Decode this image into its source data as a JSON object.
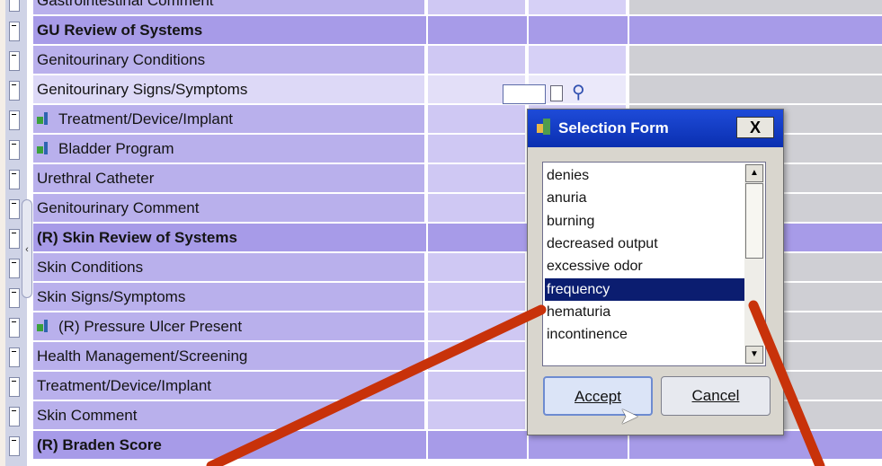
{
  "grid_rows": [
    {
      "label": "Gastrointestinal Comment",
      "type": "normal"
    },
    {
      "label": "GU Review of Systems",
      "type": "header"
    },
    {
      "label": "Genitourinary Conditions",
      "type": "normal"
    },
    {
      "label": "Genitourinary Signs/Symptoms",
      "type": "highlight"
    },
    {
      "label": "Treatment/Device/Implant",
      "type": "icon"
    },
    {
      "label": "Bladder Program",
      "type": "icon"
    },
    {
      "label": "Urethral Catheter",
      "type": "normal"
    },
    {
      "label": "Genitourinary Comment",
      "type": "normal"
    },
    {
      "label": "(R) Skin Review of Systems",
      "type": "header"
    },
    {
      "label": "Skin Conditions",
      "type": "normal"
    },
    {
      "label": "Skin Signs/Symptoms",
      "type": "normal"
    },
    {
      "label": "(R) Pressure Ulcer Present",
      "type": "icon"
    },
    {
      "label": "Health Management/Screening",
      "type": "normal"
    },
    {
      "label": "Treatment/Device/Implant",
      "type": "normal"
    },
    {
      "label": "Skin Comment",
      "type": "normal"
    },
    {
      "label": "(R) Braden Score",
      "type": "header"
    }
  ],
  "dialog": {
    "title": "Selection Form",
    "close_label": "X",
    "options": [
      "denies",
      "anuria",
      "burning",
      "decreased output",
      "excessive odor",
      "frequency",
      "hematuria",
      "incontinence"
    ],
    "selected": "frequency",
    "accept_label": "Accept",
    "cancel_label": "Cancel"
  },
  "colors": {
    "header_row": "#a79be8",
    "label_cell": "#b9b0ec",
    "selection": "#0b1d70",
    "titlebar": "#1e4bd8",
    "annotation_line": "#c8320a"
  },
  "icons": {
    "inline_lookup": "magnifier-icon",
    "inline_doc": "document-icon",
    "row_icon": "flowsheet-icon",
    "dialog_app": "app-icon",
    "cursor": "mouse-pointer-icon"
  }
}
